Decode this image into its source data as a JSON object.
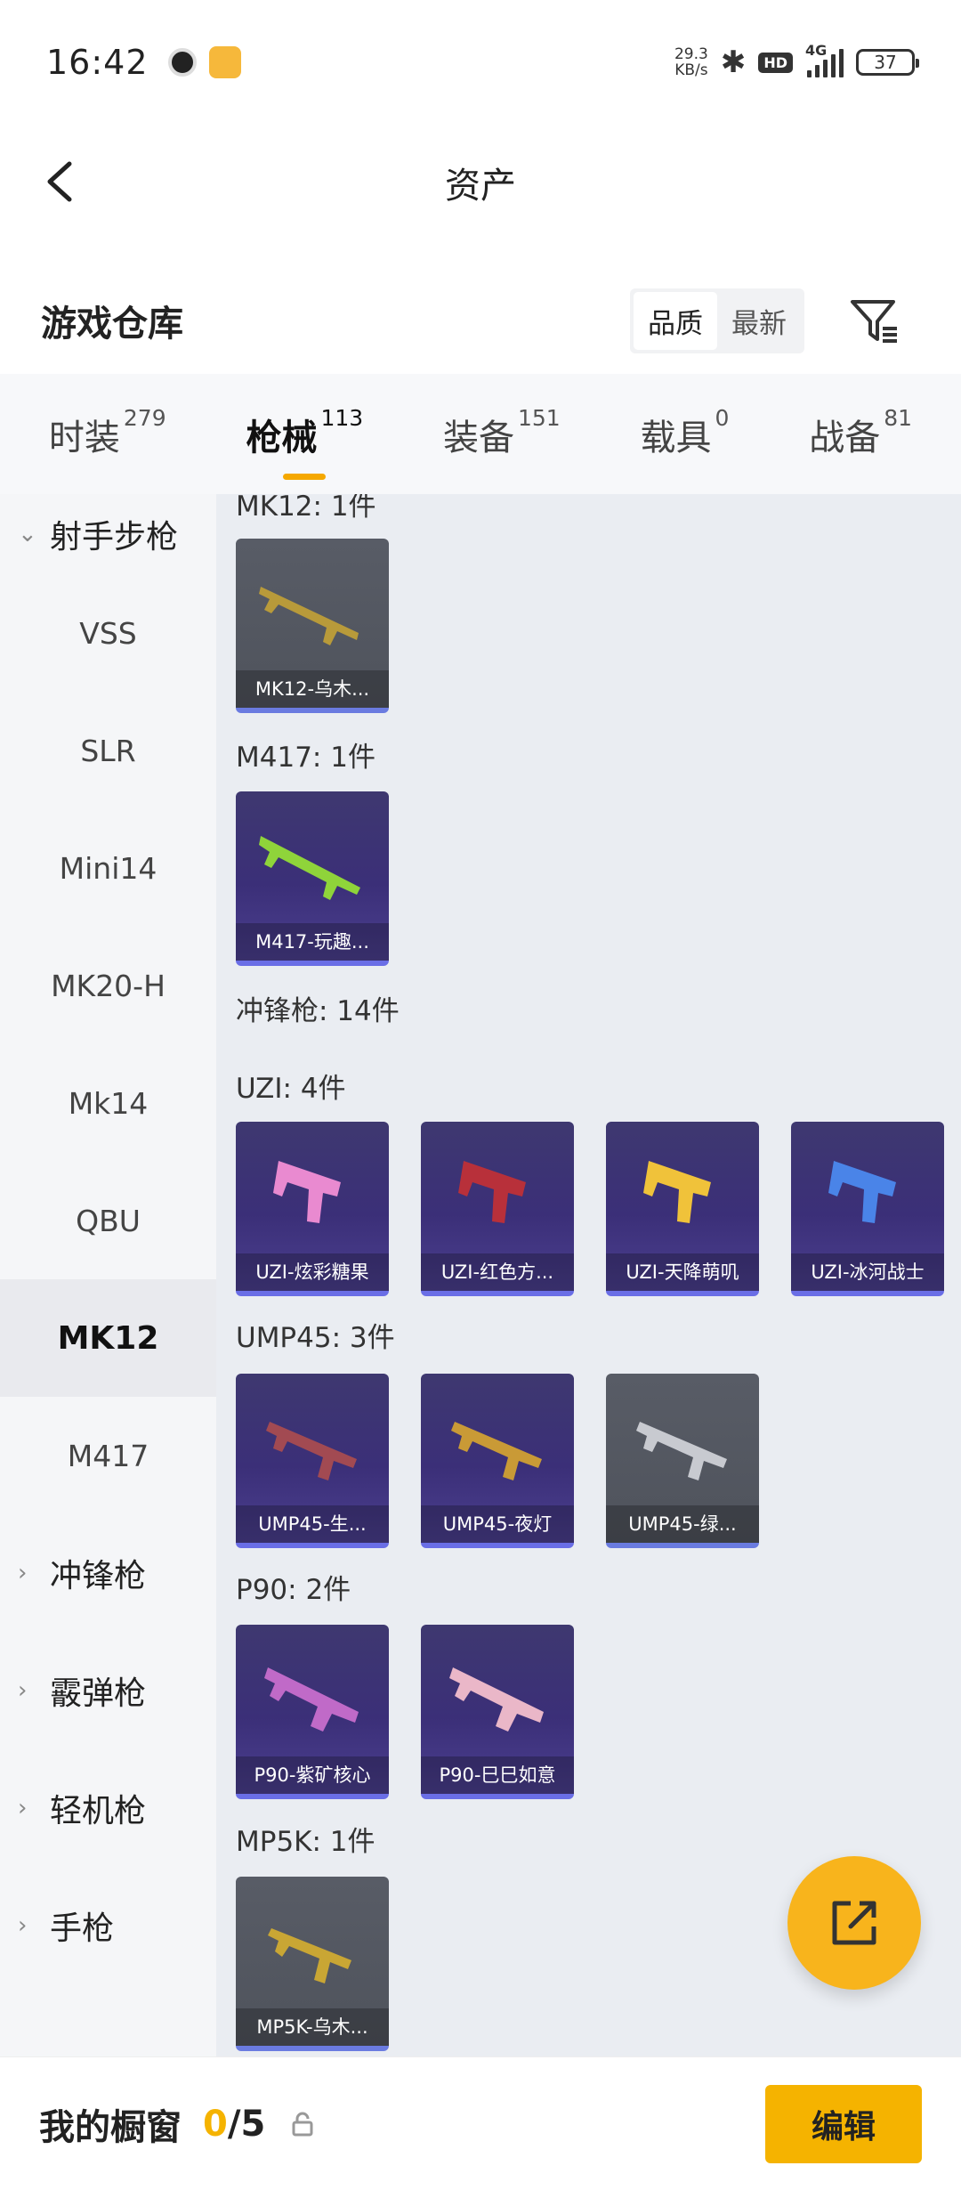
{
  "status_bar": {
    "time": "16:42",
    "net_speed_value": "29.3",
    "net_speed_unit": "KB/s",
    "hd": "HD",
    "network": "4G",
    "battery": "37"
  },
  "header": {
    "title": "资产"
  },
  "warehouse": {
    "title": "游戏仓库",
    "sort_options": [
      "品质",
      "最新"
    ],
    "sort_selected": "品质"
  },
  "tabs": [
    {
      "label": "时装",
      "count": "279"
    },
    {
      "label": "枪械",
      "count": "113",
      "active": true
    },
    {
      "label": "装备",
      "count": "151"
    },
    {
      "label": "载具",
      "count": "0"
    },
    {
      "label": "战备",
      "count": "81"
    }
  ],
  "sidebar": {
    "items": [
      {
        "label": "射手步枪",
        "type": "group",
        "expanded": true
      },
      {
        "label": "VSS"
      },
      {
        "label": "SLR"
      },
      {
        "label": "Mini14"
      },
      {
        "label": "MK20-H"
      },
      {
        "label": "Mk14"
      },
      {
        "label": "QBU"
      },
      {
        "label": "MK12",
        "active": true
      },
      {
        "label": "M417"
      },
      {
        "label": "冲锋枪",
        "type": "group"
      },
      {
        "label": "霰弹枪",
        "type": "group"
      },
      {
        "label": "轻机枪",
        "type": "group"
      },
      {
        "label": "手枪",
        "type": "group"
      }
    ]
  },
  "content": {
    "sections": [
      {
        "label": "MK12: 1件",
        "items": [
          "MK12-乌木..."
        ]
      },
      {
        "label": "M417: 1件",
        "items": [
          "M417-玩趣..."
        ]
      },
      {
        "label": "冲锋枪: 14件",
        "items": []
      },
      {
        "label": "UZI: 4件",
        "items": [
          "UZI-炫彩糖果",
          "UZI-红色方...",
          "UZI-天降萌叽",
          "UZI-冰河战士"
        ]
      },
      {
        "label": "UMP45: 3件",
        "items": [
          "UMP45-生...",
          "UMP45-夜灯",
          "UMP45-绿..."
        ]
      },
      {
        "label": "P90: 2件",
        "items": [
          "P90-紫矿核心",
          "P90-巳巳如意"
        ]
      },
      {
        "label": "MP5K: 1件",
        "items": [
          "MP5K-乌木..."
        ]
      }
    ]
  },
  "bottom": {
    "label": "我的橱窗",
    "used": "0",
    "total": "/5",
    "edit_label": "编辑"
  },
  "colors": {
    "accent": "#f5b300",
    "card_purple": "#3b2f78",
    "card_grey": "#585c66"
  }
}
